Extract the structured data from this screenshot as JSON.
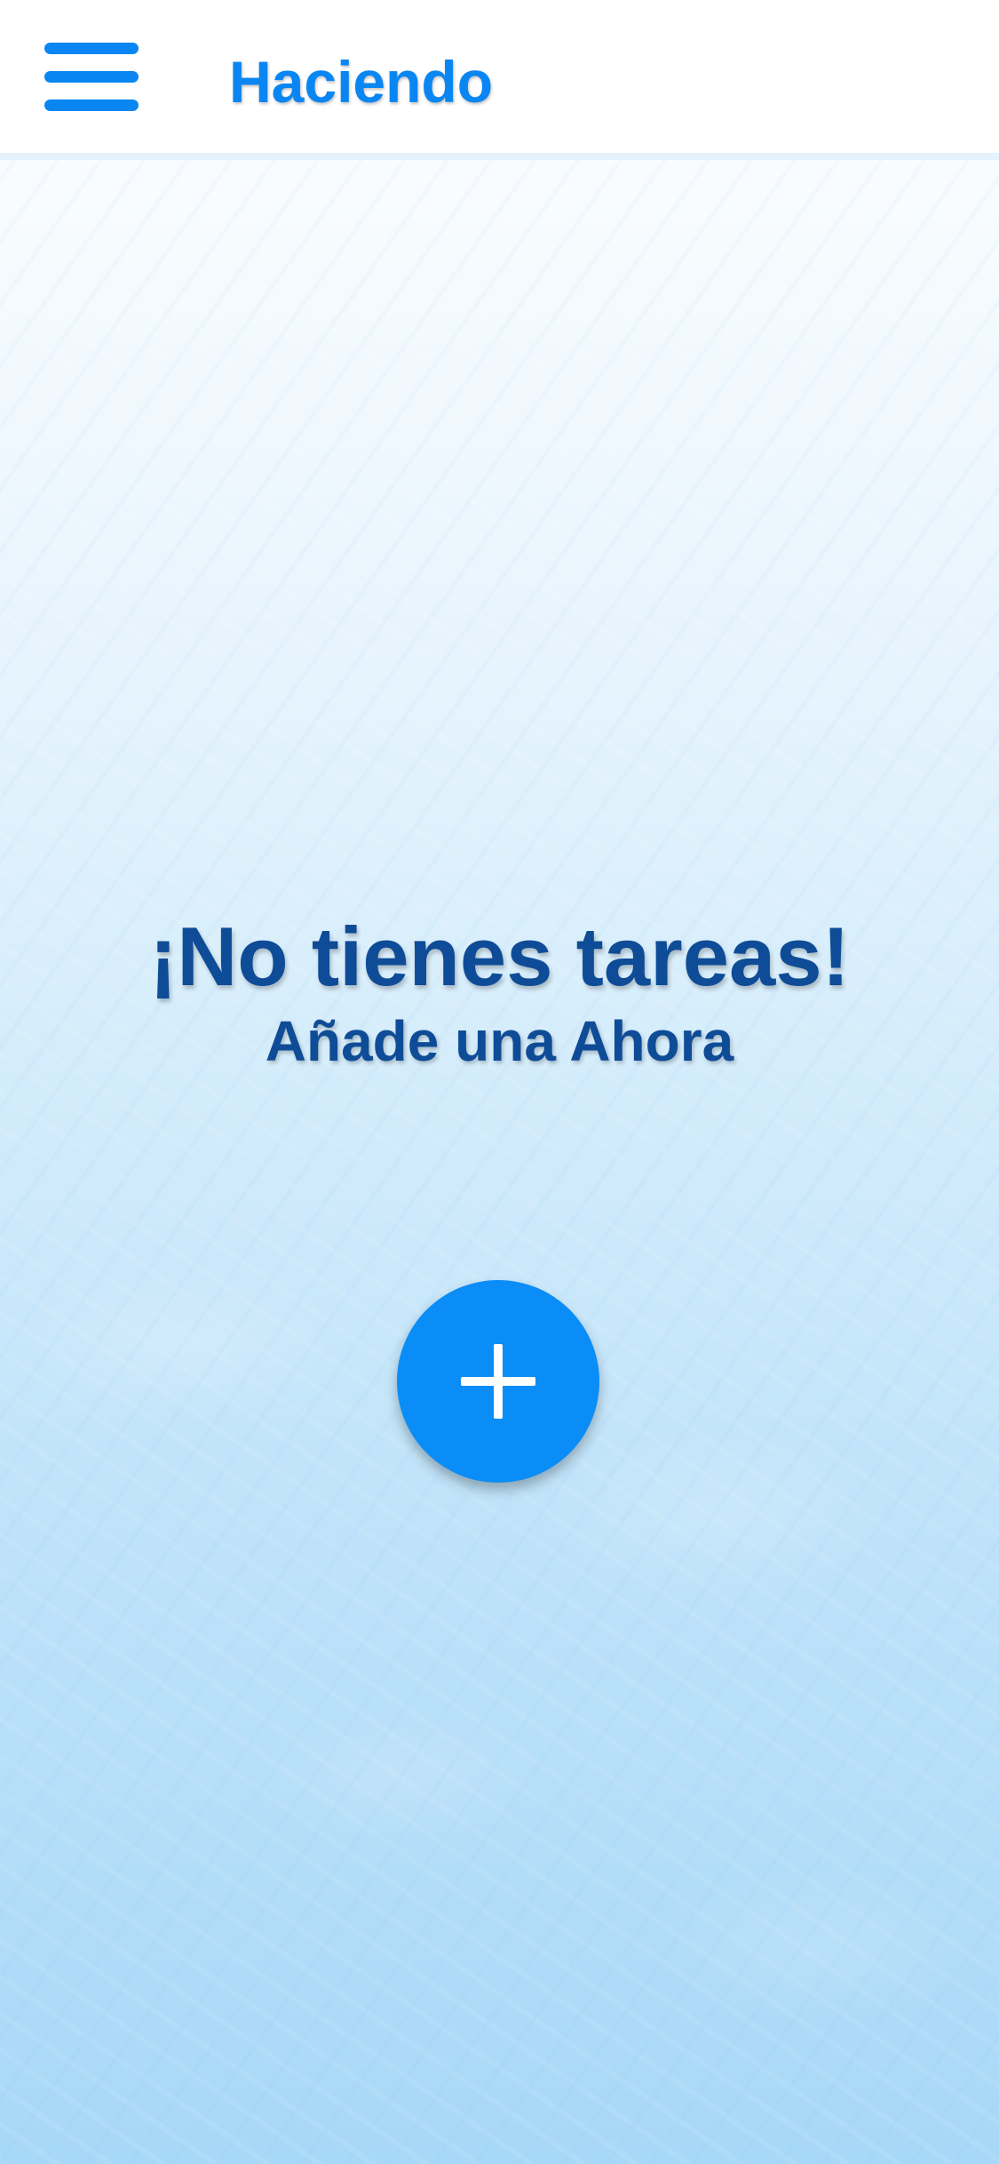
{
  "header": {
    "title": "Haciendo",
    "menu_icon": "hamburger-menu-icon"
  },
  "empty_state": {
    "title": "¡No tienes tareas!",
    "subtitle": "Añade una Ahora"
  },
  "add_button": {
    "icon": "plus-icon"
  },
  "colors": {
    "accent": "#0a86f2",
    "fab": "#0a8df7",
    "heading": "#0f4c97",
    "header_bg": "#ffffff",
    "background_top": "#ffffff",
    "background_bottom": "#a8d8f7"
  }
}
